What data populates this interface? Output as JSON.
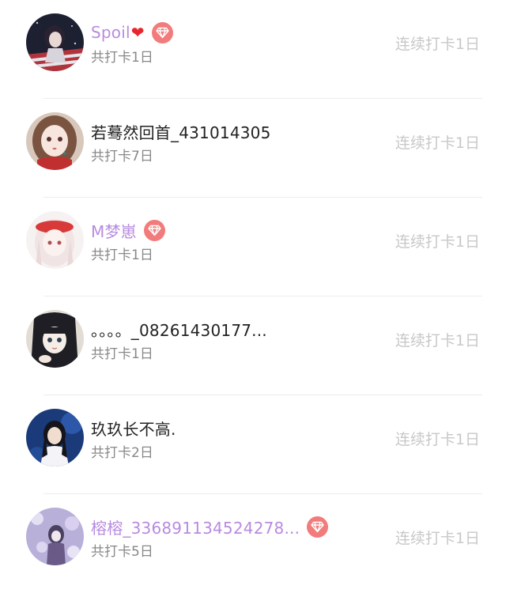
{
  "checkins": [
    {
      "name": "Spoil",
      "name_suffix": "❤",
      "vip": true,
      "total": "共打卡1日",
      "streak": "连续打卡1日",
      "avatar_icon": "avatar-dark-girl-flag"
    },
    {
      "name": "若蓦然回首_431014305",
      "vip": false,
      "total": "共打卡7日",
      "streak": "连续打卡1日",
      "avatar_icon": "avatar-anime-brown-hair"
    },
    {
      "name": "M梦崽",
      "vip": true,
      "total": "共打卡1日",
      "streak": "连续打卡1日",
      "avatar_icon": "avatar-anime-red-beret"
    },
    {
      "name": "。。。。_08261430177...",
      "vip": false,
      "total": "共打卡1日",
      "streak": "连续打卡1日",
      "avatar_icon": "avatar-anime-black-hair"
    },
    {
      "name": "玖玖长不高.",
      "vip": false,
      "total": "共打卡2日",
      "streak": "连续打卡1日",
      "avatar_icon": "avatar-photo-girl-blue"
    },
    {
      "name": "榕榕_336891134524278...",
      "vip": true,
      "total": "共打卡5日",
      "streak": "连续打卡1日",
      "avatar_icon": "avatar-lavender-flowers"
    }
  ],
  "colors": {
    "vip_name": "#b88be0",
    "vip_badge": "#f27b7b",
    "normal_name": "#222222",
    "subtext": "#888888",
    "streak": "#c8c8c8"
  }
}
